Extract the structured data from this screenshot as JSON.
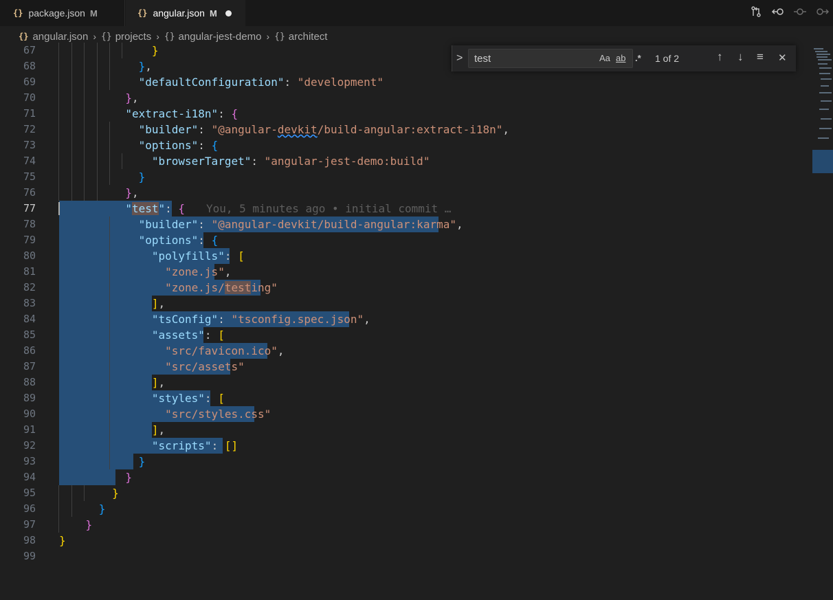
{
  "tabs": [
    {
      "icon": "{}",
      "label": "package.json",
      "status": "M"
    },
    {
      "icon": "{}",
      "label": "angular.json",
      "status": "M"
    }
  ],
  "breadcrumb": [
    {
      "icon": "{}",
      "label": "angular.json"
    },
    {
      "icon": "{}",
      "label": "projects"
    },
    {
      "icon": "{}",
      "label": "angular-jest-demo"
    },
    {
      "icon": "{}",
      "label": "architect"
    }
  ],
  "toolbar_icons": [
    "compare-changes-icon",
    "open-changes-icon",
    "git-commit-icon",
    "git-next-change-icon"
  ],
  "find_widget": {
    "toggle": ">",
    "query": "test",
    "match_case": "Aa",
    "whole_word": "ab",
    "regex": ".*",
    "result_count": "1 of 2",
    "prev_icon": "↑",
    "next_icon": "↓",
    "selection_icon": "≡",
    "close_icon": "✕"
  },
  "blame": "You, 5 minutes ago • initial commit …",
  "line_numbers": [
    "67",
    "68",
    "69",
    "70",
    "71",
    "72",
    "73",
    "74",
    "75",
    "76",
    "77",
    "78",
    "79",
    "80",
    "81",
    "82",
    "83",
    "84",
    "85",
    "86",
    "87",
    "88",
    "89",
    "90",
    "91",
    "92",
    "93",
    "94",
    "95",
    "96",
    "97",
    "98",
    "99"
  ],
  "code": {
    "l69_key": "\"defaultConfiguration\"",
    "l69_val": "\"development\"",
    "l71_key": "\"extract-i18n\"",
    "l72_key": "\"builder\"",
    "l72_val_a": "\"@angular-",
    "l72_val_b": "devkit",
    "l72_val_c": "/build-angular:extract-i18n\"",
    "l73_key": "\"options\"",
    "l74_key": "\"browserTarget\"",
    "l74_val": "\"angular-jest-demo:build\"",
    "l77_q": "\"",
    "l77_match": "test",
    "l78_key": "\"builder\"",
    "l78_val": "\"@angular-devkit/build-angular:karma\"",
    "l79_key": "\"options\"",
    "l80_key": "\"polyfills\"",
    "l81_val": "\"zone.js\"",
    "l82_val_a": "\"zone.js/",
    "l82_val_b": "test",
    "l82_val_c": "ing\"",
    "l84_key": "\"tsConfig\"",
    "l84_val": "\"tsconfig.spec.json\"",
    "l85_key": "\"assets\"",
    "l86_val": "\"src/favicon.ico\"",
    "l87_val": "\"src/assets\"",
    "l89_key": "\"styles\"",
    "l90_val": "\"src/styles.css\"",
    "l92_key": "\"scripts\""
  }
}
